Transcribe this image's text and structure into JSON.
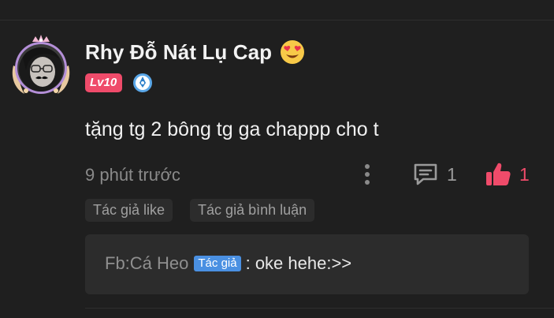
{
  "comment": {
    "username": "Rhy Đỗ Nát Lụ Cap",
    "level_badge": "Lv10",
    "text": "tặng tg 2 bông tg ga chappp cho t",
    "timestamp": "9 phút trước",
    "reply_count": "1",
    "like_count": "1",
    "tags": [
      "Tác giả like",
      "Tác giả bình luận"
    ]
  },
  "reply": {
    "author": "Fb:Cá Heo",
    "author_badge": "Tác giả",
    "text": ": oke hehe:>>"
  },
  "colors": {
    "background": "#1f1f1f",
    "accent_pink": "#ef4b6a",
    "author_badge_blue": "#4a90e2",
    "panel": "#2c2c2c"
  },
  "icons": {
    "avatar": "avatar-with-crown-frame",
    "emoji": "heart-eyes-emoji",
    "rank": "blue-rank-badge-icon",
    "more": "more-vertical-icon",
    "reply": "comment-bubble-icon",
    "like": "thumbs-up-icon"
  }
}
